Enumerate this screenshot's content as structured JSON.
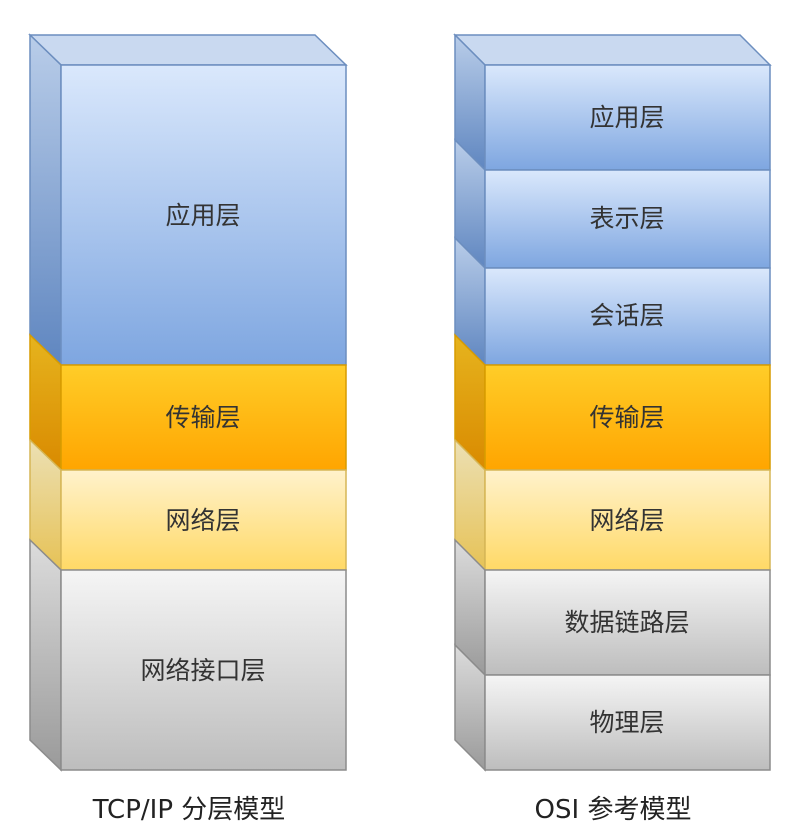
{
  "colors": {
    "application": "#7ea6e0",
    "transport": "#ffa500",
    "network": "#ffe599",
    "link": "#e0e0e0",
    "outline": "#6c8ebf"
  },
  "tcpip": {
    "caption": "TCP/IP 分层模型",
    "layers": [
      {
        "name": "应用层",
        "kind": "application"
      },
      {
        "name": "传输层",
        "kind": "transport"
      },
      {
        "name": "网络层",
        "kind": "network"
      },
      {
        "name": "网络接口层",
        "kind": "link"
      }
    ]
  },
  "osi": {
    "caption": "OSI 参考模型",
    "layers": [
      {
        "name": "应用层",
        "kind": "application"
      },
      {
        "name": "表示层",
        "kind": "application"
      },
      {
        "name": "会话层",
        "kind": "application"
      },
      {
        "name": "传输层",
        "kind": "transport"
      },
      {
        "name": "网络层",
        "kind": "network"
      },
      {
        "name": "数据链路层",
        "kind": "link"
      },
      {
        "name": "物理层",
        "kind": "link"
      }
    ]
  }
}
